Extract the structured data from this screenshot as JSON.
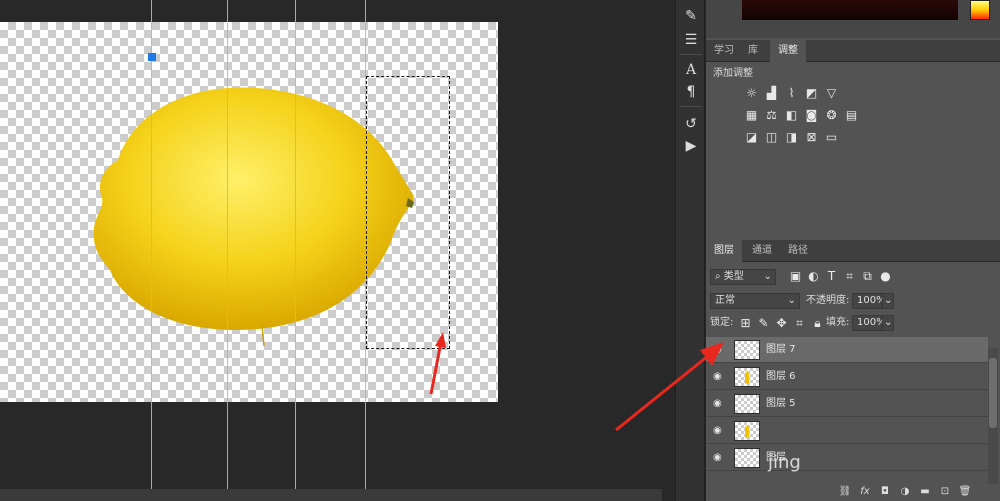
{
  "adjustments_panel": {
    "tabs": [
      "学习",
      "库",
      "调整"
    ],
    "active_tab": "调整",
    "heading": "添加调整"
  },
  "layers_panel": {
    "tabs": [
      "图层",
      "通道",
      "路径"
    ],
    "active_tab": "图层",
    "filter_label": "类型",
    "blend_mode": "正常",
    "opacity_label": "不透明度:",
    "opacity_value": "100%",
    "lock_label": "锁定:",
    "fill_label": "填充:",
    "fill_value": "100%",
    "layers": [
      {
        "name": "图层 7",
        "selected": true,
        "thumb": "transparent"
      },
      {
        "name": "图层 6",
        "selected": false,
        "thumb": "lemon-slice"
      },
      {
        "name": "图层 5",
        "selected": false,
        "thumb": "transparent"
      },
      {
        "name": "",
        "selected": false,
        "thumb": "lemon-slice"
      },
      {
        "name": "图层",
        "selected": false,
        "thumb": "transparent"
      }
    ],
    "footer_icons": [
      "link-icon",
      "fx-icon",
      "mask-icon",
      "adjustment-icon",
      "folder-icon",
      "new-layer-icon",
      "trash-icon"
    ]
  },
  "overlay_text": "jing",
  "colors": {
    "guide": "#6fd3d9",
    "selection_anchor": "#1e7ae8",
    "annotation_arrow": "#e8281e",
    "lemon": "#f5d21a"
  }
}
